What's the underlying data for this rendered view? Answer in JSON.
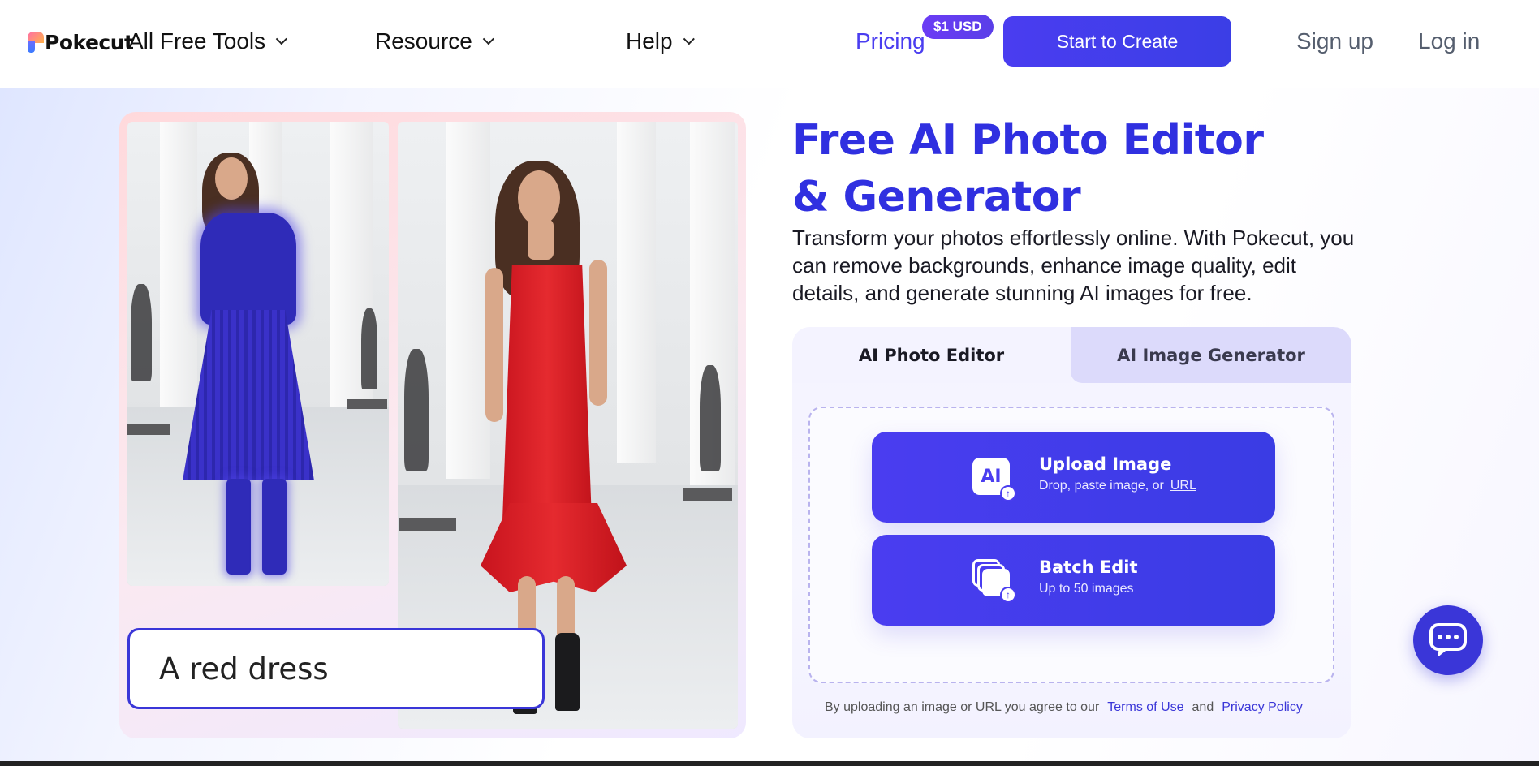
{
  "brand": {
    "name": "Pokecut",
    "accent": "#3a36d8"
  },
  "nav": {
    "items": [
      {
        "label": "All Free Tools",
        "icon": "chevron-down-icon"
      },
      {
        "label": "Resource",
        "icon": "chevron-down-icon"
      },
      {
        "label": "Help",
        "icon": "chevron-down-icon"
      }
    ],
    "pricing": "Pricing",
    "pricing_badge": "$1 USD",
    "cta": "Start to Create",
    "signup": "Sign up",
    "login": "Log in"
  },
  "hero": {
    "title": "Free AI Photo Editor & Generator",
    "subtitle": "Transform your photos effortlessly online. With Pokecut, you can remove backgrounds, enhance image quality, edit details, and generate stunning AI images for free.",
    "showcase": {
      "prompt": "A red dress"
    }
  },
  "card": {
    "tabs": [
      {
        "label": "AI Photo Editor",
        "active": true
      },
      {
        "label": "AI Image Generator",
        "active": false
      }
    ],
    "upload": {
      "icon_text": "AI",
      "title": "Upload Image",
      "subtitle": "Drop, paste image, or",
      "link": "URL"
    },
    "batch": {
      "title": "Batch Edit",
      "subtitle": "Up to 50 images"
    },
    "terms": {
      "prefix": "By uploading an image or URL you agree to our",
      "terms_link": "Terms of Use",
      "and": "and",
      "privacy_link": "Privacy Policy"
    }
  },
  "chat": {
    "icon": "chat-bubble-icon"
  }
}
